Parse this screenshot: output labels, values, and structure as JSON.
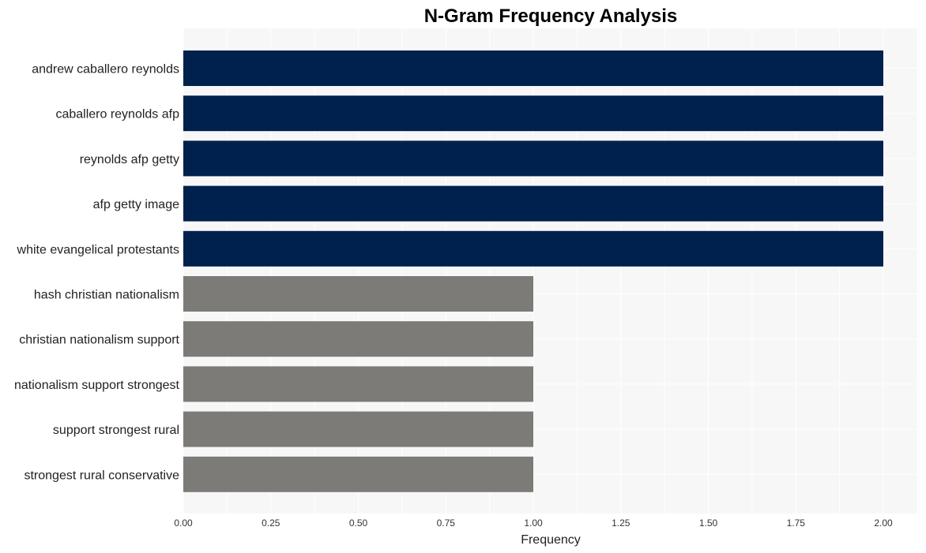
{
  "chart_data": {
    "type": "bar",
    "orientation": "horizontal",
    "title": "N-Gram Frequency Analysis",
    "xlabel": "Frequency",
    "ylabel": "",
    "xlim": [
      0,
      2.1
    ],
    "xticks": [
      "0.00",
      "0.25",
      "0.50",
      "0.75",
      "1.00",
      "1.25",
      "1.50",
      "1.75",
      "2.00"
    ],
    "xtick_values": [
      0,
      0.25,
      0.5,
      0.75,
      1.0,
      1.25,
      1.5,
      1.75,
      2.0
    ],
    "grid": true,
    "legend": "none",
    "categories": [
      "andrew caballero reynolds",
      "caballero reynolds afp",
      "reynolds afp getty",
      "afp getty image",
      "white evangelical protestants",
      "hash christian nationalism",
      "christian nationalism support",
      "nationalism support strongest",
      "support strongest rural",
      "strongest rural conservative"
    ],
    "values": [
      2,
      2,
      2,
      2,
      2,
      1,
      1,
      1,
      1,
      1
    ],
    "colors": {
      "high": "#00214d",
      "low": "#7c7b77",
      "plot_background": "#f7f7f7",
      "grid": "#ffffff"
    }
  }
}
